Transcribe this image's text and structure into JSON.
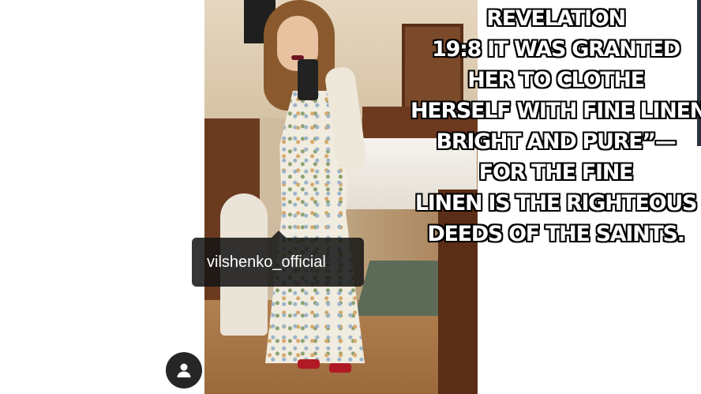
{
  "post": {
    "username_tag": "vilshenko_official"
  },
  "caption": {
    "lines": [
      "REVELATION",
      "19:8 IT WAS GRANTED",
      "HER TO CLOTHE",
      "HERSELF WITH FINE LINEN,",
      "BRIGHT AND PURE”—",
      "FOR THE FINE",
      "LINEN IS THE RIGHTEOUS",
      "DEEDS OF THE SAINTS."
    ]
  },
  "icons": {
    "avatar": "user-silhouette-icon"
  }
}
